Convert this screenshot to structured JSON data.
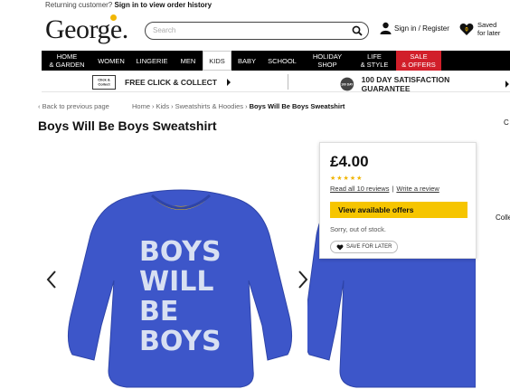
{
  "header": {
    "returning_text": "Returning customer?",
    "sign_in_order": "Sign in to view order history",
    "logo": "George.",
    "search_placeholder": "Search",
    "sign_in_register": "Sign in / Register",
    "saved_count": "0",
    "saved_line1": "Saved",
    "saved_line2": "for later"
  },
  "nav": {
    "items": [
      {
        "line1": "HOME",
        "line2": "& GARDEN"
      },
      {
        "line1": "WOMEN",
        "line2": ""
      },
      {
        "line1": "LINGERIE",
        "line2": ""
      },
      {
        "line1": "MEN",
        "line2": ""
      },
      {
        "line1": "KIDS",
        "line2": ""
      },
      {
        "line1": "BABY",
        "line2": ""
      },
      {
        "line1": "SCHOOL",
        "line2": ""
      },
      {
        "line1": "HOLIDAY",
        "line2": "SHOP"
      },
      {
        "line1": "LIFE",
        "line2": "& STYLE"
      },
      {
        "line1": "SALE",
        "line2": "& OFFERS"
      }
    ],
    "active_color": "#ffffff",
    "sale_color": "#d11f2a"
  },
  "promo": {
    "click_collect_badge_1": "Click &",
    "click_collect_badge_2": "Collect",
    "click_collect": "FREE CLICK & COLLECT",
    "satisfaction_badge": "100 DAY",
    "satisfaction": "100 DAY SATISFACTION GUARANTEE"
  },
  "breadcrumb": {
    "back": "Back to previous page",
    "items": [
      "Home",
      "Kids",
      "Sweatshirts & Hoodies",
      "Boys Will Be Boys Sweatshirt"
    ],
    "sep": "›"
  },
  "product": {
    "title": "Boys Will Be Boys Sweatshirt",
    "print_lines": [
      "BOYS",
      "WILL",
      "BE",
      "BOYS"
    ],
    "price": "£4.00",
    "stars": "★★★★★",
    "read_reviews": "Read all 10 reviews",
    "review_sep": "|",
    "write_review": "Write a review",
    "offers_button": "View available offers",
    "stock_status": "Sorry, out of stock.",
    "save_later": "SAVE FOR LATER",
    "rating": 5,
    "sweatshirt_color": "#3d56c9",
    "accent_color": "#f6c500"
  },
  "edge": {
    "right_c": "C",
    "right_colle": "Colle"
  }
}
